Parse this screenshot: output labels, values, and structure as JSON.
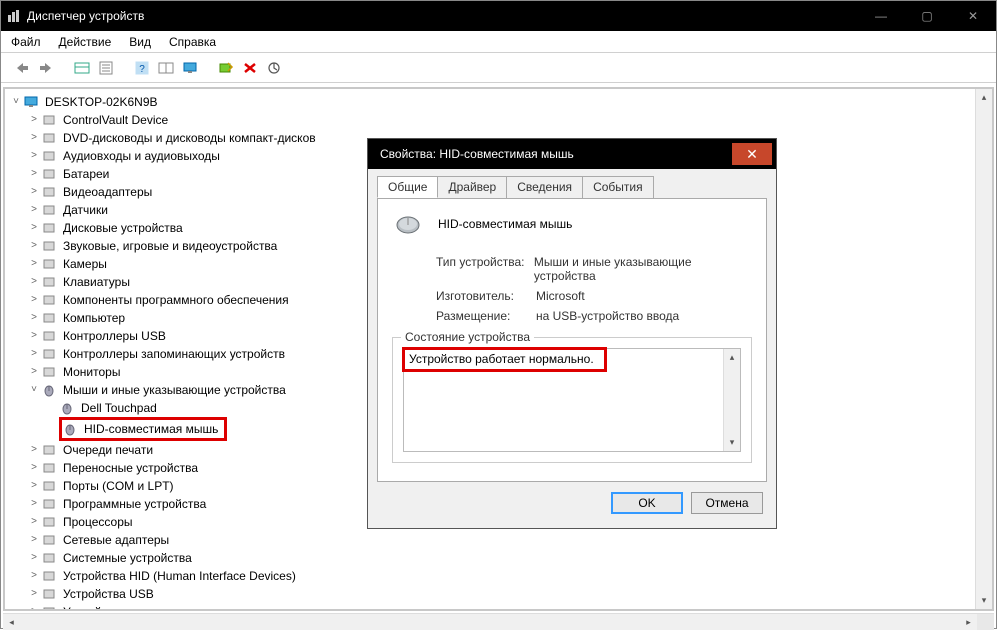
{
  "window": {
    "title": "Диспетчер устройств"
  },
  "menu": {
    "file": "Файл",
    "action": "Действие",
    "view": "Вид",
    "help": "Справка"
  },
  "tree": {
    "root": "DESKTOP-02K6N9B",
    "items": [
      "ControlVault Device",
      "DVD-дисководы и дисководы компакт-дисков",
      "Аудиовходы и аудиовыходы",
      "Батареи",
      "Видеоадаптеры",
      "Датчики",
      "Дисковые устройства",
      "Звуковые, игровые и видеоустройства",
      "Камеры",
      "Клавиатуры",
      "Компоненты программного обеспечения",
      "Компьютер",
      "Контроллеры USB",
      "Контроллеры запоминающих устройств",
      "Мониторы",
      "Мыши и иные указывающие устройства",
      "Очереди печати",
      "Переносные устройства",
      "Порты (COM и LPT)",
      "Программные устройства",
      "Процессоры",
      "Сетевые адаптеры",
      "Системные устройства",
      "Устройства HID (Human Interface Devices)",
      "Устройства USB",
      "Устройства чтения смарт-карт"
    ],
    "mouse_children": {
      "touchpad": "Dell Touchpad",
      "hid_mouse": "HID-совместимая мышь"
    }
  },
  "dialog": {
    "title": "Свойства: HID-совместимая мышь",
    "tabs": {
      "general": "Общие",
      "driver": "Драйвер",
      "details": "Сведения",
      "events": "События"
    },
    "device_name": "HID-совместимая мышь",
    "type_label": "Тип устройства:",
    "type_value": "Мыши и иные указывающие устройства",
    "mfr_label": "Изготовитель:",
    "mfr_value": "Microsoft",
    "loc_label": "Размещение:",
    "loc_value": "на USB-устройство ввода",
    "status_group": "Состояние устройства",
    "status_text": "Устройство работает нормально.",
    "ok": "OK",
    "cancel": "Отмена"
  }
}
